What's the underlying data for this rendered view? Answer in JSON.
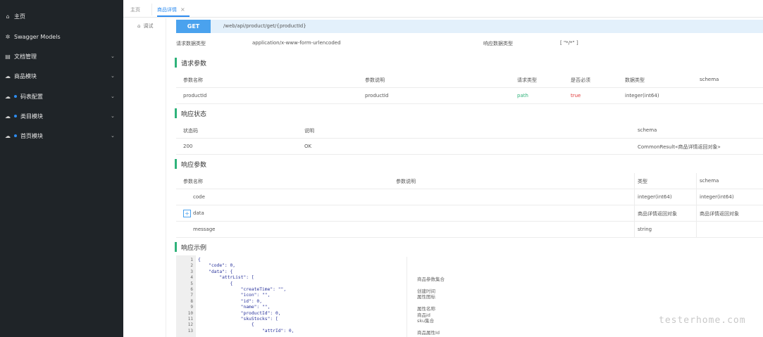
{
  "sidebar": {
    "items": [
      {
        "label": "主页",
        "icon": "home-icon",
        "dot": false,
        "chevron": false
      },
      {
        "label": "Swagger Models",
        "icon": "gear-icon",
        "dot": false,
        "chevron": false
      },
      {
        "label": "文档管理",
        "icon": "document-icon",
        "dot": false,
        "chevron": true
      },
      {
        "label": "商品模块",
        "icon": "cloud-icon",
        "dot": false,
        "chevron": true
      },
      {
        "label": "码表配置",
        "icon": "cloud-icon",
        "dot": true,
        "chevron": true
      },
      {
        "label": "类目模块",
        "icon": "cloud-icon",
        "dot": true,
        "chevron": true
      },
      {
        "label": "首页模块",
        "icon": "cloud-icon",
        "dot": true,
        "chevron": true
      }
    ]
  },
  "tabs": {
    "home": "主页",
    "active": "商品详情",
    "close": "×"
  },
  "test_label": "调试",
  "request": {
    "method": "GET",
    "path": "/web/api/product/get/{productId}",
    "req_type_label": "请求数据类型",
    "req_type_value": "application/x-www-form-urlencoded",
    "resp_type_label": "响应数据类型",
    "resp_type_value": "[ \"*/*\" ]"
  },
  "params": {
    "title": "请求参数",
    "headers": [
      "参数名称",
      "参数说明",
      "请求类型",
      "是否必须",
      "数据类型",
      "schema"
    ],
    "rows": [
      [
        "productId",
        "productId",
        "path",
        "true",
        "integer(int64)",
        ""
      ]
    ]
  },
  "status": {
    "title": "响应状态",
    "headers": [
      "状态码",
      "说明",
      "schema"
    ],
    "rows": [
      [
        "200",
        "OK",
        "CommonResult«商品详情返回对象»"
      ]
    ]
  },
  "resp_params": {
    "title": "响应参数",
    "headers": [
      "参数名称",
      "参数说明",
      "类型",
      "schema"
    ],
    "rows": [
      [
        "code",
        "",
        "integer(int64)",
        "integer(int64)"
      ],
      [
        "data",
        "",
        "商品详情返回对象",
        "商品详情返回对象"
      ],
      [
        "message",
        "",
        "string",
        ""
      ]
    ],
    "expand": "+"
  },
  "example": {
    "title": "响应示例",
    "lines": [
      {
        "n": "1",
        "t": "{"
      },
      {
        "n": "2",
        "t": "    \"code\": 0,"
      },
      {
        "n": "3",
        "t": "    \"data\": {"
      },
      {
        "n": "4",
        "t": "        \"attrList\": ["
      },
      {
        "n": "5",
        "t": "            {"
      },
      {
        "n": "6",
        "t": "                \"createTime\": \"\","
      },
      {
        "n": "7",
        "t": "                \"icon\": \"\","
      },
      {
        "n": "8",
        "t": "                \"id\": 0,"
      },
      {
        "n": "9",
        "t": "                \"name\": \"\","
      },
      {
        "n": "10",
        "t": "                \"productId\": 0,"
      },
      {
        "n": "11",
        "t": "                \"skuStocks\": ["
      },
      {
        "n": "12",
        "t": "                    {"
      },
      {
        "n": "13",
        "t": "                        \"attrId\": 0,"
      }
    ],
    "comments": [
      {
        "line": 4,
        "t": "商品参数集合"
      },
      {
        "line": 6,
        "t": "创建时间"
      },
      {
        "line": 7,
        "t": "属性图标"
      },
      {
        "line": 9,
        "t": "属性名称"
      },
      {
        "line": 10,
        "t": "商品id"
      },
      {
        "line": 11,
        "t": "sku集合"
      },
      {
        "line": 13,
        "t": "商品属性Id"
      }
    ]
  },
  "watermark": "testerhome.com",
  "colors": {
    "sidebar_bg": "#1f2428",
    "accent": "#2d8cf0",
    "section_bar": "#2fb27a",
    "get_button": "#4aa2ee",
    "required_true": "#e03b3b",
    "path_green": "#2fb27a"
  }
}
